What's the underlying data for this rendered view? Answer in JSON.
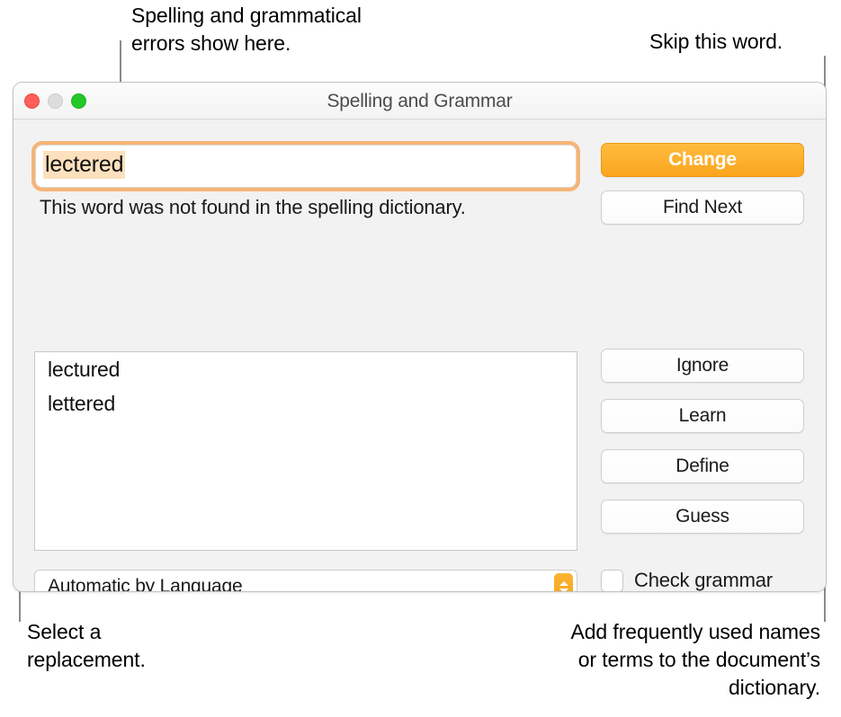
{
  "window": {
    "title": "Spelling and Grammar",
    "traffic_lights": [
      {
        "name": "close",
        "color": "#ff5f57"
      },
      {
        "name": "minimize",
        "color": "#dddddd"
      },
      {
        "name": "zoom",
        "color": "#22c927"
      }
    ]
  },
  "spellcheck": {
    "misspelled_word": "lectered",
    "status_message": "This word was not found in the spelling dictionary.",
    "suggestions": [
      "lectured",
      "lettered"
    ],
    "language_popup": {
      "selected": "Automatic by Language",
      "stepper_icon": "updown-chevron-icon"
    },
    "check_grammar": {
      "label": "Check grammar",
      "checked": false
    }
  },
  "buttons": {
    "change": "Change",
    "find_next": "Find Next",
    "ignore": "Ignore",
    "learn": "Learn",
    "define": "Define",
    "guess": "Guess"
  },
  "callouts": {
    "errors": "Spelling and grammatical\nerrors show here.",
    "skip": "Skip this word.",
    "select": "Select a\nreplacement.",
    "add": "Add frequently used names\nor terms to the document’s\ndictionary."
  },
  "colors": {
    "accent_orange": "#f9a51d",
    "highlight_peach": "#fde0bd",
    "focus_ring": "#f7af6a",
    "leader_line": "#8a8a8a"
  }
}
